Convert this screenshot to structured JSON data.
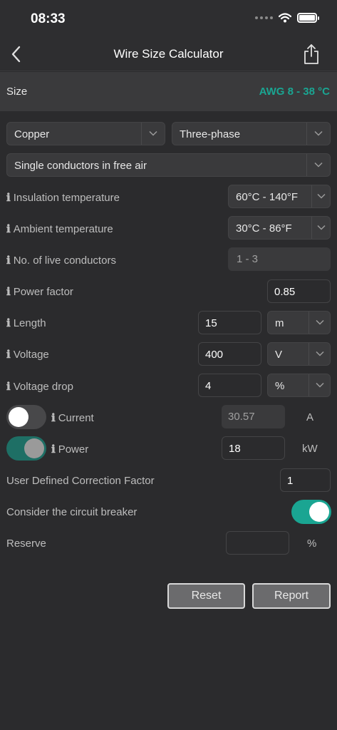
{
  "status_bar": {
    "time": "08:33"
  },
  "nav": {
    "title": "Wire Size Calculator"
  },
  "size": {
    "label": "Size",
    "value": "AWG 8 - 38 °C"
  },
  "selects": {
    "material": "Copper",
    "phase": "Three-phase",
    "installation": "Single conductors in free air"
  },
  "rows": {
    "insulation_temp": {
      "label": "Insulation temperature",
      "value": "60°C - 140°F"
    },
    "ambient_temp": {
      "label": "Ambient temperature",
      "value": "30°C - 86°F"
    },
    "live_conductors": {
      "label": "No. of live conductors",
      "value": "1 - 3"
    },
    "power_factor": {
      "label": "Power factor",
      "value": "0.85"
    },
    "length": {
      "label": "Length",
      "value": "15",
      "unit": "m"
    },
    "voltage": {
      "label": "Voltage",
      "value": "400",
      "unit": "V"
    },
    "voltage_drop": {
      "label": "Voltage drop",
      "value": "4",
      "unit": "%"
    },
    "current": {
      "label": "Current",
      "value": "30.57",
      "unit": "A"
    },
    "power": {
      "label": "Power",
      "value": "18",
      "unit": "kW"
    },
    "correction": {
      "label": "User Defined Correction Factor",
      "value": "1"
    },
    "breaker": {
      "label": "Consider the circuit breaker"
    },
    "reserve": {
      "label": "Reserve",
      "value": "",
      "unit": "%"
    }
  },
  "info_glyph": "ℹ",
  "buttons": {
    "reset": "Reset",
    "report": "Report"
  },
  "colors": {
    "accent": "#1aa592",
    "background": "#2b2b2d"
  }
}
